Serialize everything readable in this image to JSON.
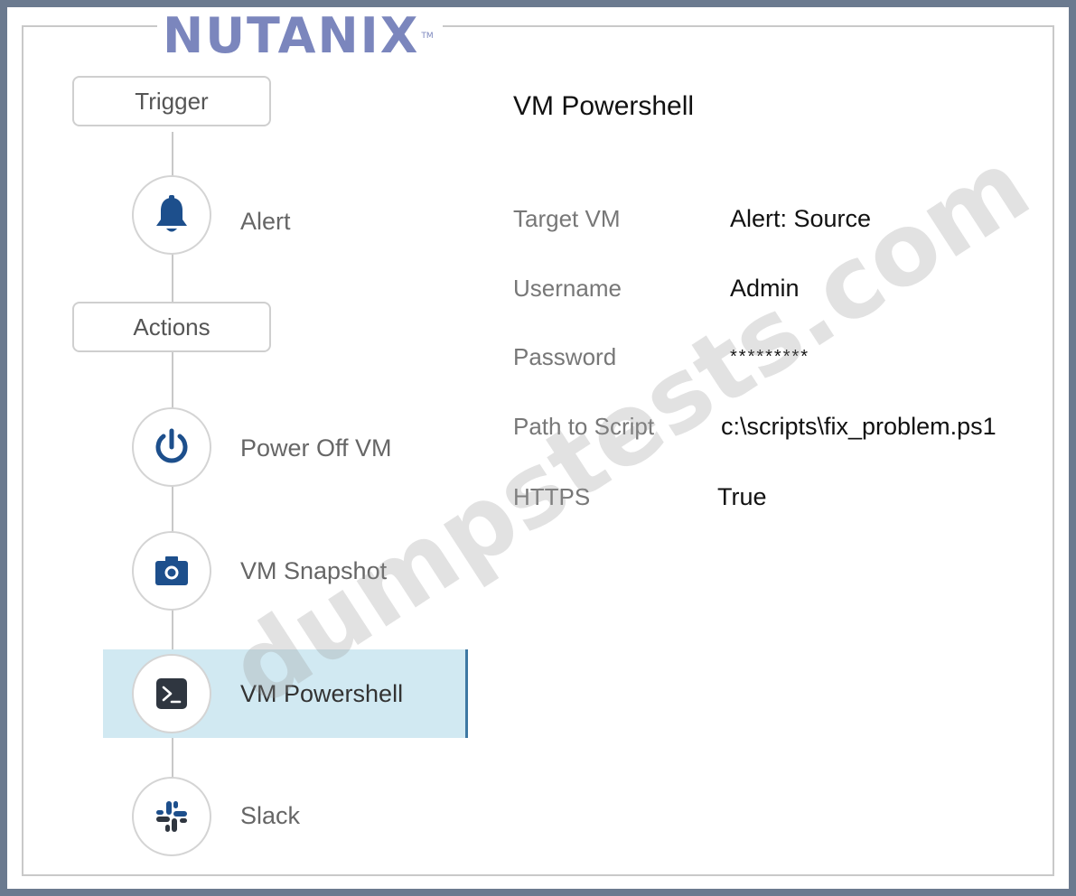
{
  "brand": {
    "logo_text": "NUTANIX",
    "trademark": "TM"
  },
  "workflow": {
    "trigger_label": "Trigger",
    "actions_label": "Actions",
    "trigger_items": [
      {
        "label": "Alert",
        "icon": "bell-icon"
      }
    ],
    "action_items": [
      {
        "label": "Power Off VM",
        "icon": "power-icon"
      },
      {
        "label": "VM Snapshot",
        "icon": "camera-icon"
      },
      {
        "label": "VM Powershell",
        "icon": "powershell-icon",
        "selected": true
      },
      {
        "label": "Slack",
        "icon": "slack-icon"
      }
    ]
  },
  "detail_panel": {
    "title": "VM Powershell",
    "fields": [
      {
        "label": "Target VM",
        "value": "Alert: Source"
      },
      {
        "label": "Username",
        "value": "Admin"
      },
      {
        "label": "Password",
        "value": "*********"
      },
      {
        "label": "Path to Script",
        "value": "c:\\scripts\\fix_problem.ps1"
      },
      {
        "label": "HTTPS",
        "value": "True"
      }
    ]
  },
  "watermark": {
    "text": "dumpstests.com"
  },
  "colors": {
    "accent": "#1d4f8c",
    "selection_bg": "#d1e9f2",
    "selection_border": "#3e78a3",
    "logo": "#7b86bd"
  }
}
